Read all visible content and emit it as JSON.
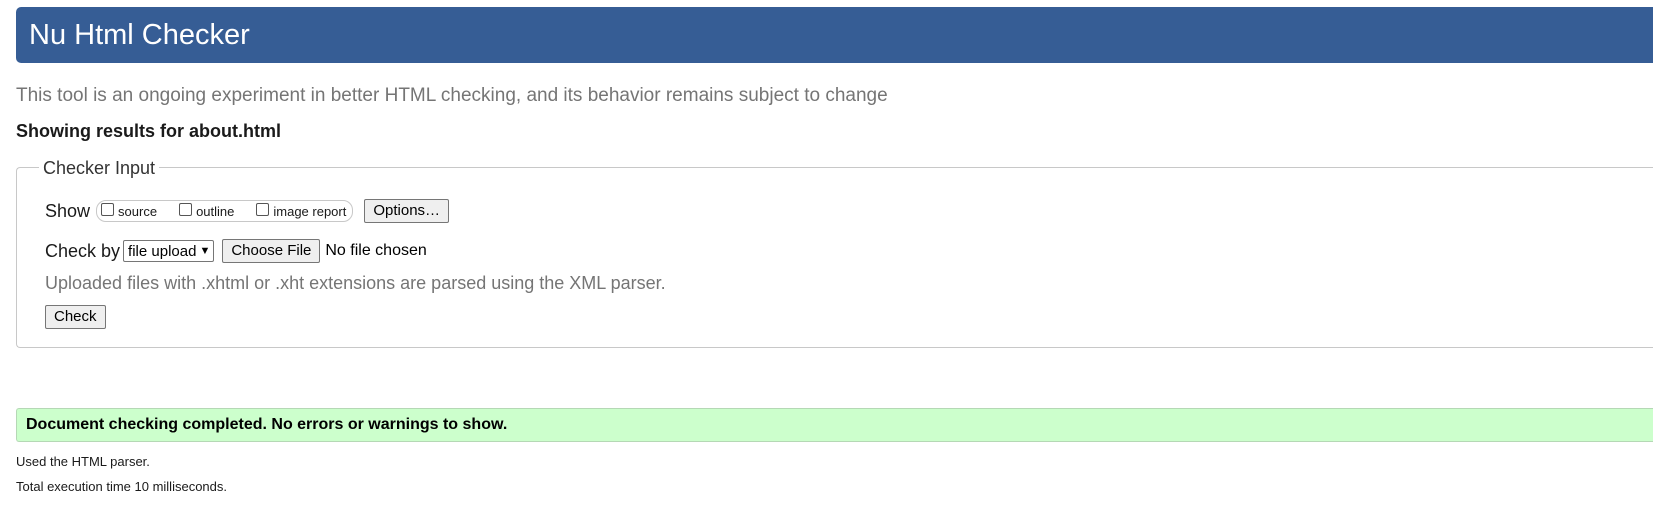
{
  "header": {
    "title": "Nu Html Checker",
    "bg_color": "#365d95"
  },
  "intro_text": "This tool is an ongoing experiment in better HTML checking, and its behavior remains subject to change",
  "results_for": "Showing results for about.html",
  "checker_input": {
    "legend": "Checker Input",
    "show_label": "Show",
    "show_options": [
      {
        "label": "source",
        "checked": false
      },
      {
        "label": "outline",
        "checked": false
      },
      {
        "label": "image report",
        "checked": false
      }
    ],
    "options_button": "Options…",
    "check_by_label": "Check by",
    "check_by_selected": "file upload",
    "choose_file_button": "Choose File",
    "no_file_text": "No file chosen",
    "upload_note": "Uploaded files with .xhtml or .xht extensions are parsed using the XML parser.",
    "check_button": "Check"
  },
  "result": {
    "message": "Document checking completed. No errors or warnings to show.",
    "bg_color": "#ccffcc",
    "parser_note": "Used the HTML parser.",
    "execution_time": "Total execution time 10 milliseconds."
  }
}
